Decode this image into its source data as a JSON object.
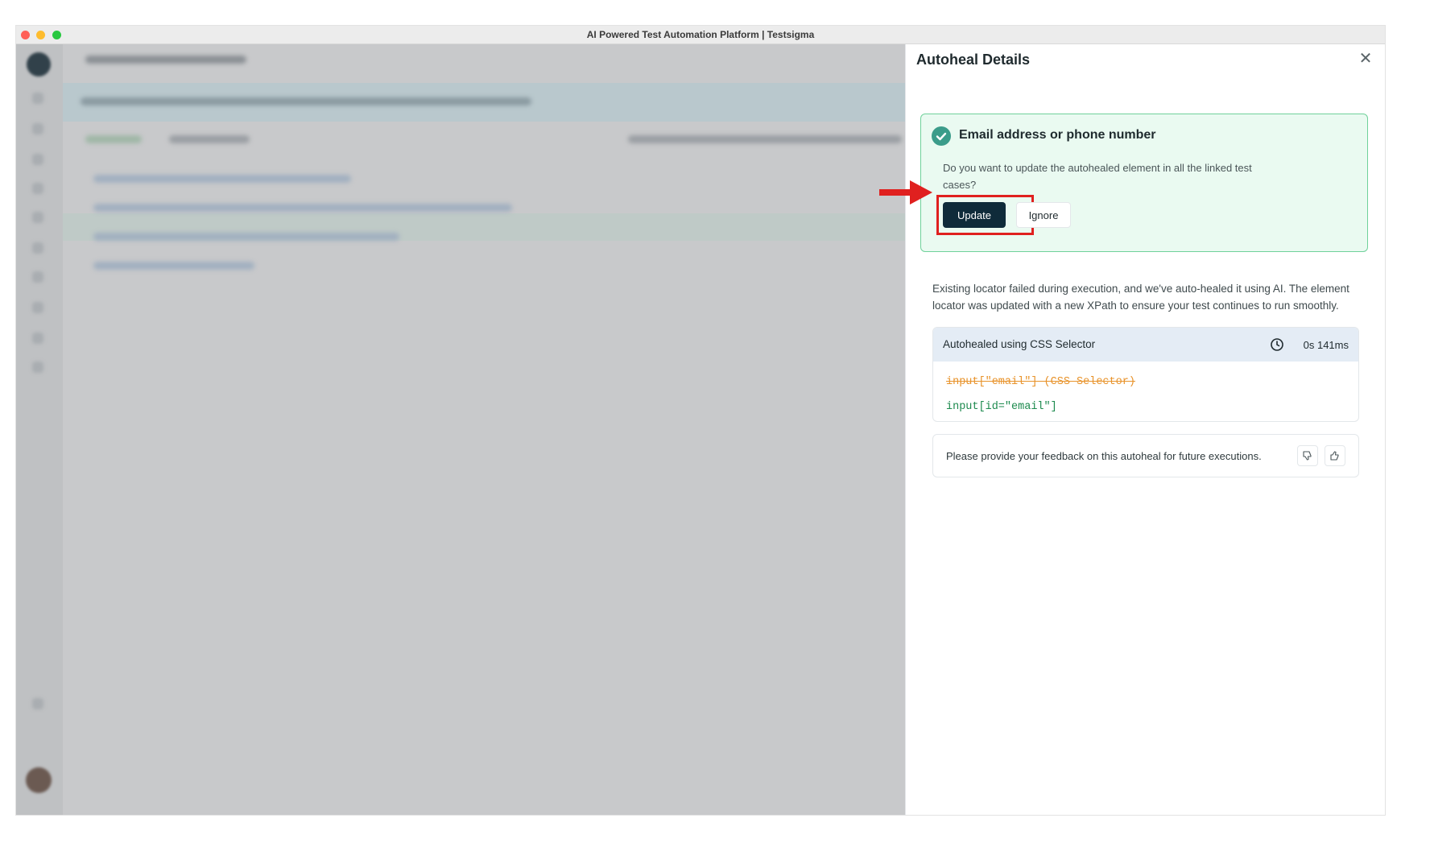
{
  "window": {
    "title": "AI Powered Test Automation Platform | Testsigma"
  },
  "drawer": {
    "title": "Autoheal Details",
    "close_icon": "close-icon",
    "prompt": {
      "heading": "Email address or phone number",
      "icon": "verified-badge-icon",
      "text": "Do you want to update the autohealed element in all the linked test cases?",
      "update_label": "Update",
      "ignore_label": "Ignore"
    },
    "description": "Existing locator failed during execution, and we've auto-healed it using AI. The element locator was updated with a new XPath to ensure your test continues to run smoothly.",
    "selector": {
      "label": "Autohealed using CSS Selector",
      "duration": "0s 141ms",
      "old_locator": "input[\"email\"] (CSS Selector)",
      "new_locator": "input[id=\"email\"]"
    },
    "feedback": {
      "text": "Please provide your feedback on this autoheal for future executions.",
      "thumbs_down_icon": "thumbs-down-icon",
      "thumbs_up_icon": "thumbs-up-icon"
    }
  },
  "colors": {
    "primary": "#0f2b3a",
    "highlight": "#e0201f",
    "success_bg": "#eafaf1",
    "success_border": "#6fd19a",
    "old_locator": "#e8932b",
    "new_locator": "#1d8a4e"
  }
}
